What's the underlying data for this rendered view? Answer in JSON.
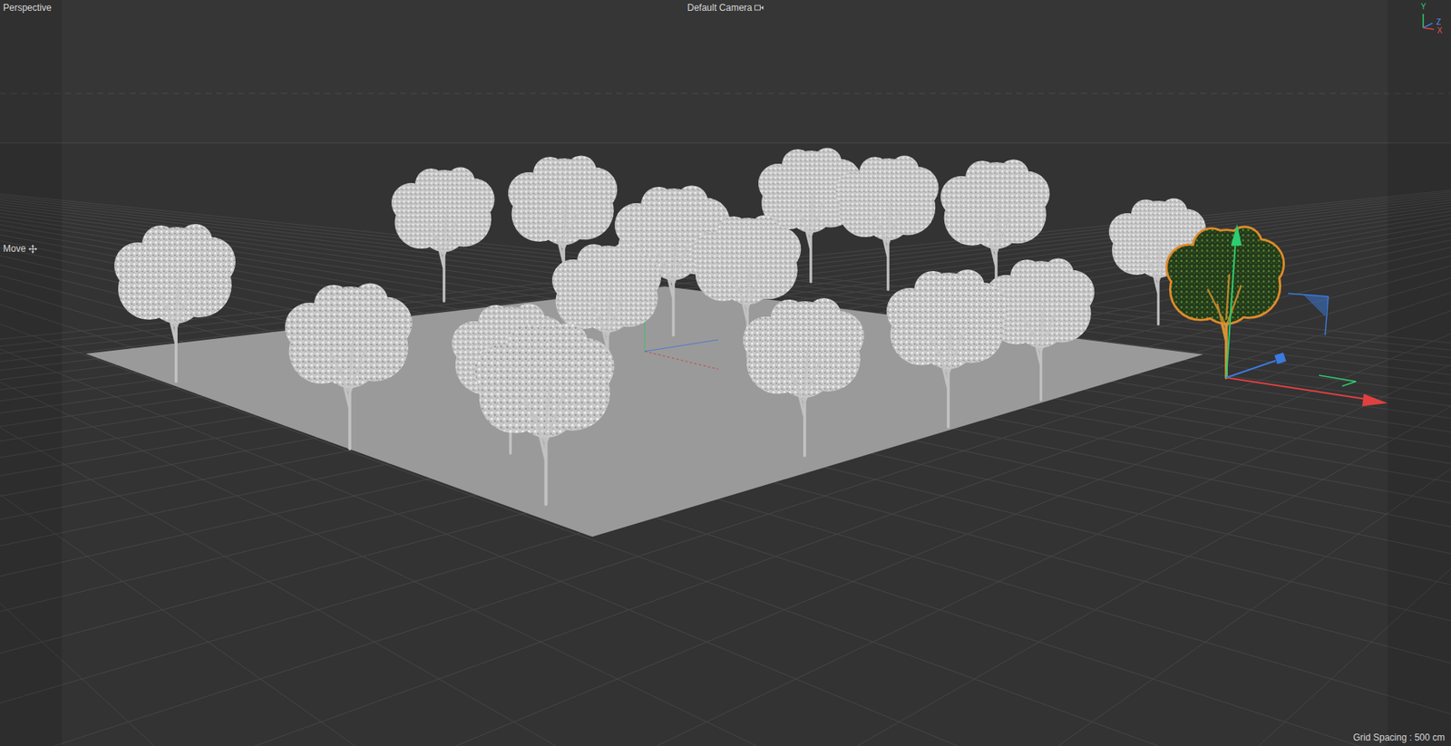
{
  "viewport": {
    "view": "Perspective",
    "camera": "Default Camera",
    "tool": "Move",
    "grid_spacing": "Grid Spacing : 500 cm"
  },
  "axis_widget": {
    "y": "Y",
    "z": "Z",
    "x": "X"
  },
  "scene": {
    "trees": [
      {
        "selected": false
      },
      {
        "selected": false
      },
      {
        "selected": false
      },
      {
        "selected": false
      },
      {
        "selected": false
      },
      {
        "selected": false
      },
      {
        "selected": false
      },
      {
        "selected": false
      },
      {
        "selected": false
      },
      {
        "selected": false
      },
      {
        "selected": false
      },
      {
        "selected": false
      },
      {
        "selected": false
      },
      {
        "selected": false
      },
      {
        "selected": false
      },
      {
        "selected": false
      },
      {
        "selected": true
      }
    ]
  }
}
